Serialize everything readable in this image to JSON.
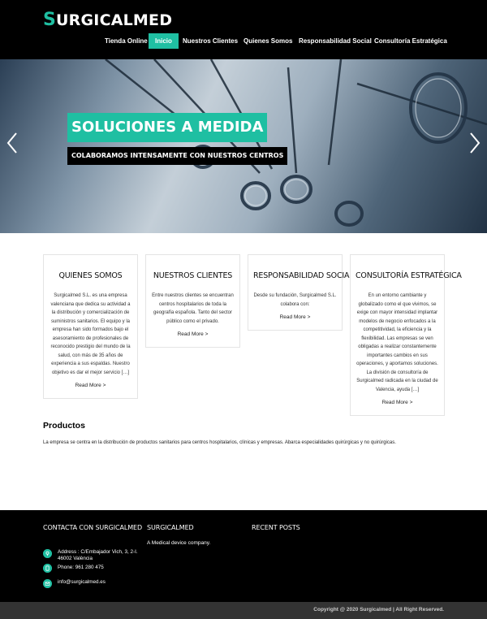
{
  "brand": {
    "logo_first": "S",
    "logo_rest": "URGICALMED",
    "accent": "#1fbfa2"
  },
  "nav": {
    "items": [
      "Tienda Online",
      "Inicio",
      "Nuestros Clientes",
      "Quienes Somos",
      "Responsabilidad Social",
      "Consultoría Estratégica"
    ],
    "active": "Inicio"
  },
  "hero": {
    "title": "SOLUCIONES A MEDIDA",
    "subtitle": "COLABORAMOS INTENSAMENTE CON NUESTROS CENTROS",
    "prev_icon": "chevron-left-icon",
    "next_icon": "chevron-right-icon"
  },
  "cards": [
    {
      "title": "QUIENES SOMOS",
      "text": "Surgicalmed S.L. es una empresa valenciana que dedica su actividad a la distribución y comercialización de suministros sanitarios. El equipo y la empresa han sido formados bajo el asesoramiento de profesionales de reconocido prestigio del mundo de la salud, con más de 35 años de experiencia a sus espaldas. Nuestro objetivo es dar el mejor servicio […]",
      "more": "Read More >"
    },
    {
      "title": "NUESTROS CLIENTES",
      "text": "Entre nuestros clientes se encuentran centros hospitalarios de toda la geografía española. Tanto del sector público como el privado.",
      "more": "Read More >"
    },
    {
      "title": "RESPONSABILIDAD SOCIAL",
      "text": "Desde su fundación, Surgicalmed S.L. colabora con:",
      "more": "Read More >"
    },
    {
      "title": "CONSULTORÍA ESTRATÉGICA",
      "text": "En un entorno cambiante y globalizado como el que vivimos, se exige con mayor intensidad implantar modelos de negocio enfocados a la competitividad, la eficiencia y la flexibilidad. Las empresas se ven obligadas a realizar constantemente importantes cambios en sus operaciones, y aportamos soluciones. La división de consultoría de Surgicalmed radicada en la ciudad de Valencia, ayuda […]",
      "more": "Read More >"
    }
  ],
  "products": {
    "title": "Productos",
    "text": "La empresa se centra en la distribución de productos sanitarios para centros hospitalarios, clínicas y empresas. Abarca especialidades quirúrgicas y no quirúrgicas."
  },
  "footer": {
    "contact_title": "CONTACTA CON SURGICALMED",
    "address": "Address : C/Embajador Vich, 3, 2-I. 46002 València",
    "phone": "Phone: 961 280 475",
    "email": "info@surgicalmed.es",
    "company_title": "SURGICALMED",
    "company_desc": "A Medical device company.",
    "posts_title": "RECENT POSTS",
    "icons": [
      "map-pin-icon",
      "phone-icon",
      "envelope-icon"
    ]
  },
  "copyright": "Copyright @ 2020 Surgicalmed | All Right Reserved."
}
